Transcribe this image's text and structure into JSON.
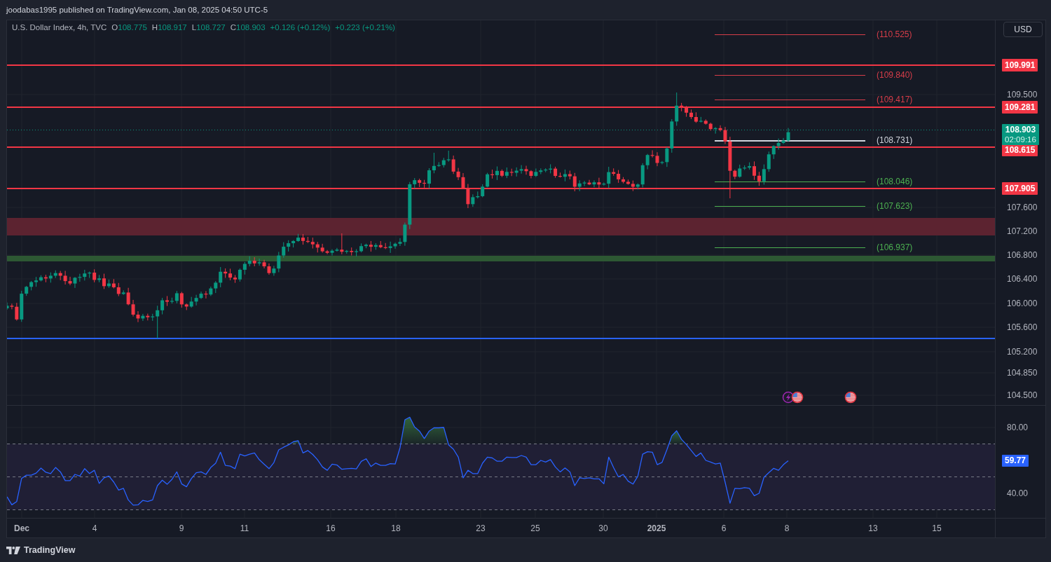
{
  "header": {
    "text": "joodabas1995 published on TradingView.com, Jan 08, 2025 04:50 UTC-5"
  },
  "legend": {
    "title": "U.S. Dollar Index, 4h, TVC",
    "ohlc": [
      {
        "key": "O",
        "value": "108.775"
      },
      {
        "key": "H",
        "value": "108.917"
      },
      {
        "key": "L",
        "value": "108.727"
      },
      {
        "key": "C",
        "value": "108.903"
      }
    ],
    "changes": [
      "+0.126 (+0.12%)",
      "+0.223 (+0.21%)"
    ]
  },
  "projections": [
    {
      "label": "(110.525)",
      "color": "#d63d49"
    },
    {
      "label": "(109.840)",
      "color": "#d63d49"
    },
    {
      "label": "(109.417)",
      "color": "#d63d49"
    },
    {
      "label": "(108.731)",
      "color": "#d1d4dc"
    },
    {
      "label": "(108.046)",
      "color": "#4caf50"
    },
    {
      "label": "(107.623)",
      "color": "#4caf50"
    },
    {
      "label": "(106.937)",
      "color": "#4caf50"
    }
  ],
  "price_axis": {
    "currency_button": "USD",
    "ticks": [
      "109.500",
      "107.600",
      "107.200",
      "106.800",
      "106.400",
      "106.000",
      "105.600",
      "105.200",
      "104.850",
      "104.500"
    ],
    "level_tags": [
      "109.991",
      "109.281",
      "108.615",
      "107.905"
    ],
    "current_price": {
      "price": "108.903",
      "countdown": "02:09:16"
    }
  },
  "rsi": {
    "value_tag": "59.77",
    "chart_data": {
      "type": "line",
      "series": [
        {
          "color": "#2962ff",
          "values": [
            37.9,
            33,
            35,
            49,
            51,
            51,
            52.3,
            55.3,
            52.8,
            52,
            55.7,
            53,
            47.7,
            47.7,
            51.5,
            50.5,
            55,
            52,
            54,
            46,
            49.4,
            50.5,
            46.8,
            42,
            43,
            36,
            32.8,
            33,
            35.7,
            35,
            36,
            44.7,
            48,
            45.5,
            48.5,
            53,
            45.7,
            44,
            49,
            52.5,
            53,
            51.5,
            55.7,
            58.3,
            65,
            57,
            56.5,
            55,
            63.8,
            62.7,
            63.8,
            64.5,
            60.4,
            57.7,
            55,
            58.7,
            66.4,
            68,
            69.4,
            71.3,
            72,
            64.5,
            66,
            63.6,
            60.4,
            56,
            54,
            57.7,
            57.2,
            54.6,
            55,
            55.2,
            54.8,
            59.4,
            61,
            56.3,
            58.4,
            57,
            57,
            58,
            57.8,
            67.8,
            84.7,
            86.2,
            80.3,
            77.8,
            73.3,
            77.8,
            79.8,
            79.8,
            80,
            69.5,
            66.8,
            62,
            49.4,
            54,
            52,
            52,
            58.3,
            62,
            61.5,
            59.5,
            59.5,
            62,
            61.8,
            61.8,
            63,
            62,
            57.4,
            57.4,
            60,
            59,
            60.5,
            56,
            53,
            55.4,
            53,
            44.7,
            49.4,
            49,
            49.4,
            48.8,
            48.8,
            45.8,
            62,
            55.6,
            50,
            51.4,
            47.4,
            45.6,
            50.4,
            63.8,
            65.3,
            65,
            57.4,
            58.8,
            66.6,
            74.9,
            78,
            72.8,
            69.6,
            66,
            62.4,
            64.5,
            60,
            59,
            57.8,
            58.4,
            46.6,
            34,
            43,
            42.8,
            43.5,
            43,
            38.6,
            40,
            49.8,
            52.5,
            55.2,
            54,
            57.4,
            59.8
          ]
        }
      ],
      "ylim": [
        25.1,
        93.2
      ],
      "yticks": [
        {
          "value": 80,
          "label": "80.00"
        },
        {
          "value": 40,
          "label": "40.00"
        }
      ]
    }
  },
  "time_axis": [
    {
      "label": "Dec",
      "kind": "major"
    },
    {
      "label": "4",
      "kind": "minor"
    },
    {
      "label": "9",
      "kind": "minor"
    },
    {
      "label": "11",
      "kind": "minor"
    },
    {
      "label": "16",
      "kind": "minor"
    },
    {
      "label": "18",
      "kind": "minor"
    },
    {
      "label": "23",
      "kind": "minor"
    },
    {
      "label": "25",
      "kind": "minor"
    },
    {
      "label": "30",
      "kind": "minor"
    },
    {
      "label": "2025",
      "kind": "major"
    },
    {
      "label": "6",
      "kind": "minor"
    },
    {
      "label": "8",
      "kind": "minor"
    },
    {
      "label": "13",
      "kind": "minor"
    },
    {
      "label": "15",
      "kind": "minor"
    }
  ],
  "footer": {
    "brand": "TradingView"
  }
}
